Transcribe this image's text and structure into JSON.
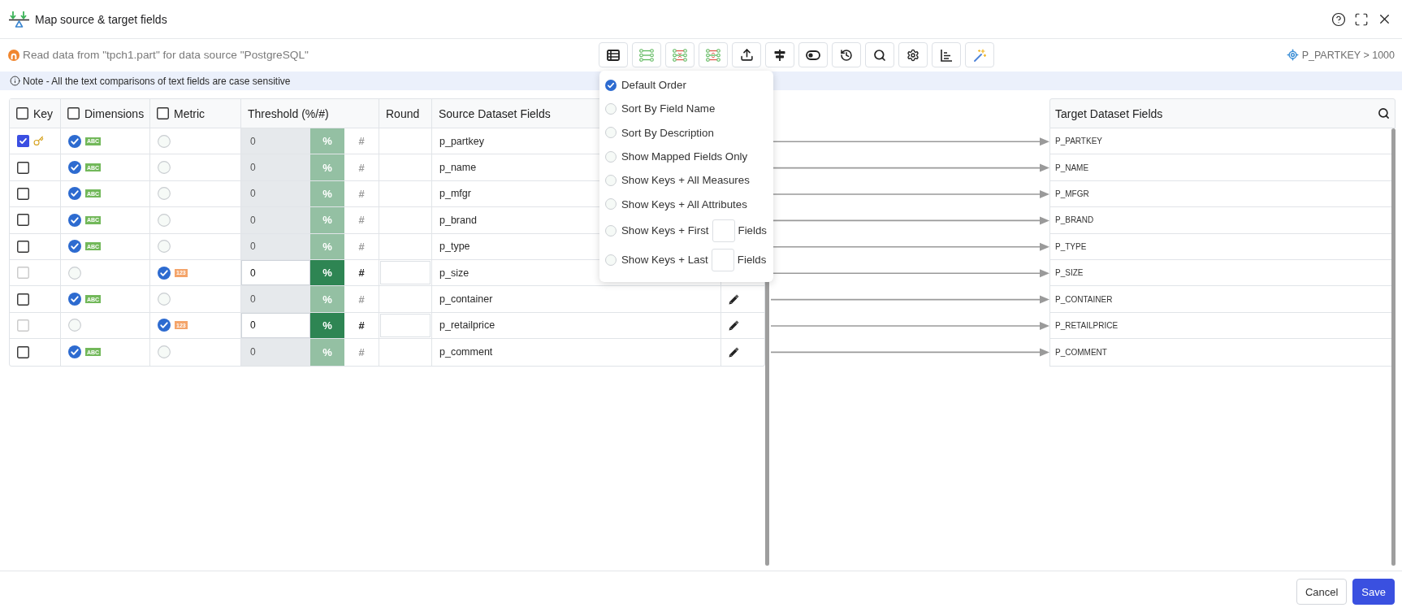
{
  "window": {
    "title": "Map source & target fields"
  },
  "source_info": {
    "text": "Read data from \"tpch1.part\" for data source \"PostgreSQL\""
  },
  "filter": {
    "text": "P_PARTKEY > 1000"
  },
  "note": {
    "text": "Note - All the text comparisons of text fields are case sensitive"
  },
  "sort_menu": {
    "items": [
      {
        "kind": "option",
        "label": "Default Order",
        "selected": true
      },
      {
        "kind": "option",
        "label": "Sort By Field Name",
        "selected": false
      },
      {
        "kind": "option",
        "label": "Sort By Description",
        "selected": false
      },
      {
        "kind": "option",
        "label": "Show Mapped Fields Only",
        "selected": false
      },
      {
        "kind": "option",
        "label": "Show Keys + All Measures",
        "selected": false
      },
      {
        "kind": "option",
        "label": "Show Keys + All Attributes",
        "selected": false
      },
      {
        "kind": "count",
        "label": "Show Keys + First",
        "suffix": "Fields",
        "selected": false
      },
      {
        "kind": "count",
        "label": "Show Keys + Last",
        "suffix": "Fields",
        "selected": false
      }
    ]
  },
  "source_table": {
    "columns": [
      {
        "kind": "checkbox",
        "label": "Key",
        "checked": false
      },
      {
        "kind": "checkbox",
        "label": "Dimensions",
        "checked": false
      },
      {
        "kind": "checkbox",
        "label": "Metric",
        "checked": false
      },
      {
        "kind": "text",
        "label": "Threshold (%/#)"
      },
      {
        "kind": "text",
        "label": "Round"
      },
      {
        "kind": "text",
        "label": "Source Dataset Fields"
      }
    ],
    "rows": [
      {
        "key": true,
        "key_enabled": true,
        "dimension": true,
        "metric": false,
        "type": "ABC",
        "threshold": {
          "value": "0",
          "enabled": false,
          "units": [
            {
              "label": "%",
              "selected": true
            },
            {
              "label": "#",
              "selected": false
            }
          ]
        },
        "field": "p_partkey",
        "edit": false,
        "mapped": true
      },
      {
        "key": false,
        "key_enabled": true,
        "dimension": true,
        "metric": false,
        "type": "ABC",
        "threshold": {
          "value": "0",
          "enabled": false,
          "units": [
            {
              "label": "%",
              "selected": true
            },
            {
              "label": "#",
              "selected": false
            }
          ]
        },
        "field": "p_name",
        "edit": false,
        "mapped": true
      },
      {
        "key": false,
        "key_enabled": true,
        "dimension": true,
        "metric": false,
        "type": "ABC",
        "threshold": {
          "value": "0",
          "enabled": false,
          "units": [
            {
              "label": "%",
              "selected": true
            },
            {
              "label": "#",
              "selected": false
            }
          ]
        },
        "field": "p_mfgr",
        "edit": false,
        "mapped": true
      },
      {
        "key": false,
        "key_enabled": true,
        "dimension": true,
        "metric": false,
        "type": "ABC",
        "threshold": {
          "value": "0",
          "enabled": false,
          "units": [
            {
              "label": "%",
              "selected": true
            },
            {
              "label": "#",
              "selected": false
            }
          ]
        },
        "field": "p_brand",
        "edit": false,
        "mapped": true
      },
      {
        "key": false,
        "key_enabled": true,
        "dimension": true,
        "metric": false,
        "type": "ABC",
        "threshold": {
          "value": "0",
          "enabled": false,
          "units": [
            {
              "label": "%",
              "selected": true
            },
            {
              "label": "#",
              "selected": false
            }
          ]
        },
        "field": "p_type",
        "edit": false,
        "mapped": true
      },
      {
        "key": false,
        "key_enabled": false,
        "dimension": false,
        "metric": true,
        "type": "123",
        "threshold": {
          "value": "0",
          "enabled": true,
          "units": [
            {
              "label": "%",
              "selected": true
            },
            {
              "label": "#",
              "selected": false
            }
          ]
        },
        "field": "p_size",
        "edit": false,
        "mapped": true
      },
      {
        "key": false,
        "key_enabled": true,
        "dimension": true,
        "metric": false,
        "type": "ABC",
        "threshold": {
          "value": "0",
          "enabled": false,
          "units": [
            {
              "label": "%",
              "selected": true
            },
            {
              "label": "#",
              "selected": false
            }
          ]
        },
        "field": "p_container",
        "edit": true,
        "mapped": true
      },
      {
        "key": false,
        "key_enabled": false,
        "dimension": false,
        "metric": true,
        "type": "123",
        "threshold": {
          "value": "0",
          "enabled": true,
          "units": [
            {
              "label": "%",
              "selected": true
            },
            {
              "label": "#",
              "selected": false
            }
          ]
        },
        "field": "p_retailprice",
        "edit": true,
        "mapped": true
      },
      {
        "key": false,
        "key_enabled": true,
        "dimension": true,
        "metric": false,
        "type": "ABC",
        "threshold": {
          "value": "0",
          "enabled": false,
          "units": [
            {
              "label": "%",
              "selected": true
            },
            {
              "label": "#",
              "selected": false
            }
          ]
        },
        "field": "p_comment",
        "edit": true,
        "mapped": true
      }
    ]
  },
  "target_table": {
    "title": "Target Dataset Fields",
    "rows": [
      {
        "field": "P_PARTKEY"
      },
      {
        "field": "P_NAME"
      },
      {
        "field": "P_MFGR"
      },
      {
        "field": "P_BRAND"
      },
      {
        "field": "P_TYPE"
      },
      {
        "field": "P_SIZE"
      },
      {
        "field": "P_CONTAINER"
      },
      {
        "field": "P_RETAILPRICE"
      },
      {
        "field": "P_COMMENT"
      }
    ]
  },
  "footer": {
    "buttons": [
      {
        "kind": "secondary",
        "label": "Cancel"
      },
      {
        "kind": "primary",
        "label": "Save"
      }
    ]
  }
}
